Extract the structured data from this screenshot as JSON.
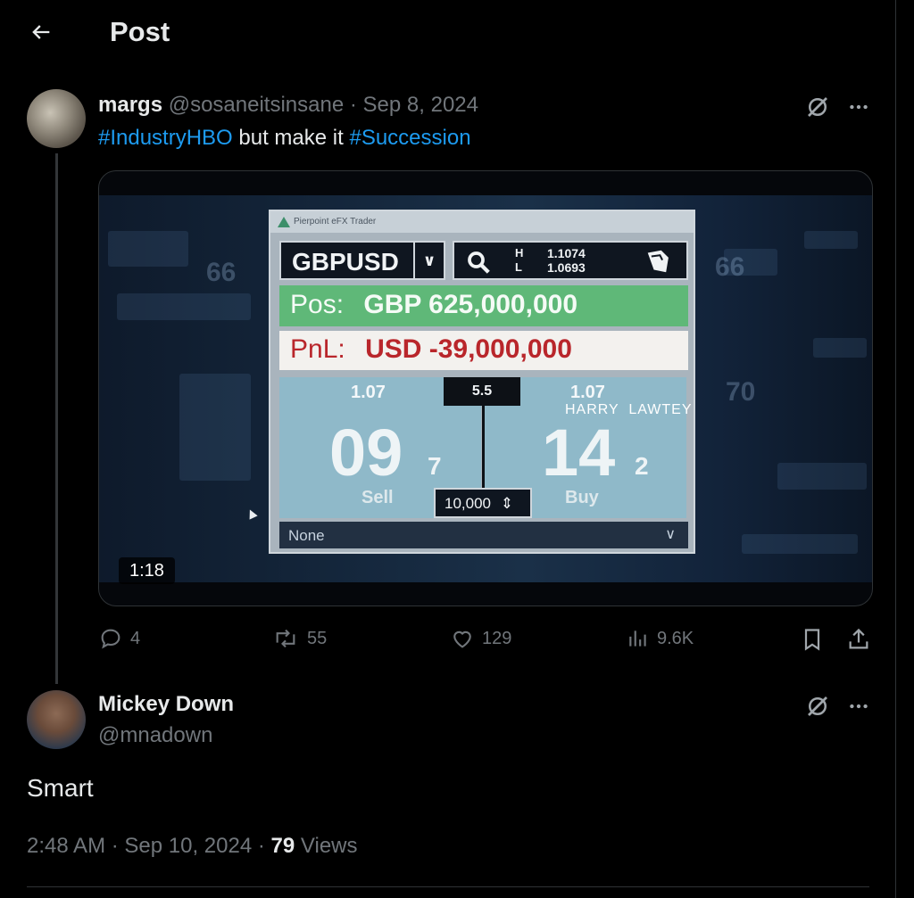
{
  "header": {
    "title": "Post"
  },
  "post": {
    "author_name": "margs",
    "author_handle": "@sosaneitsinsane",
    "separator": "·",
    "date": "Sep 8, 2024",
    "text_parts": [
      "#IndustryHBO",
      " but make it ",
      "#Succession"
    ],
    "media": {
      "duration": "1:18",
      "caption": "HARRY  LAWTEY",
      "trader_window": {
        "title": "Pierpoint eFX Trader",
        "currency_pair": "GBPUSD",
        "high_label": "H",
        "low_label": "L",
        "high": "1.1074",
        "low": "1.0693",
        "position_label": "Pos:",
        "position_value": "GBP 625,000,000",
        "pnl_label": "PnL:",
        "pnl_value": "USD -39,000,000",
        "spread": "5.5",
        "sell": {
          "rate": "1.07",
          "big": "09",
          "pip": "7",
          "label": "Sell"
        },
        "buy": {
          "rate": "1.07",
          "big": "14",
          "pip": "2",
          "label": "Buy"
        },
        "quantity": "10,000",
        "account": "None",
        "ghost_numbers": [
          "66",
          "66",
          "70"
        ]
      }
    },
    "stats": {
      "replies": "4",
      "reposts": "55",
      "likes": "129",
      "views": "9.6K"
    }
  },
  "reply": {
    "author_name": "Mickey Down",
    "author_handle": "@mnadown",
    "text": "Smart",
    "time": "2:48 AM",
    "separator": "·",
    "date": "Sep 10, 2024",
    "views_count": "79",
    "views_label": "Views"
  },
  "colors": {
    "background": "#000000",
    "text": "#e7e9ea",
    "muted": "#71767b",
    "link": "#1d9bf0",
    "border": "#2f3336"
  },
  "icons": {
    "back": "arrow-left-icon",
    "grok": "grok-icon",
    "more": "more-icon",
    "reply": "reply-icon",
    "repost": "repost-icon",
    "like": "heart-icon",
    "views": "views-icon",
    "bookmark": "bookmark-icon",
    "share": "share-icon"
  }
}
